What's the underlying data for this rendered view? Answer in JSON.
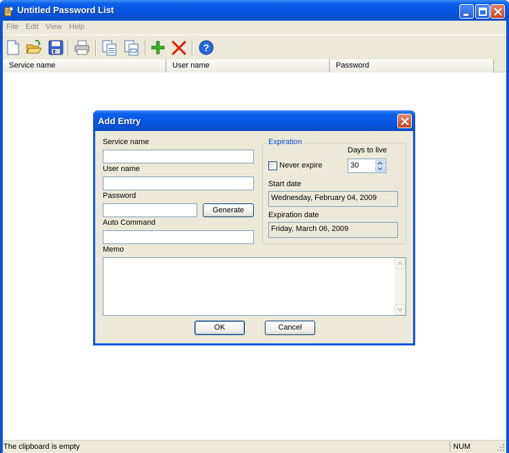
{
  "window": {
    "title": "Untitled Password List"
  },
  "menu": [
    "File",
    "Edit",
    "View",
    "Help"
  ],
  "toolbar": {
    "items": [
      "new-file-icon",
      "open-folder-icon",
      "save-icon",
      "print-icon",
      "copy-user-icon",
      "copy-password-icon",
      "add-entry-icon",
      "delete-entry-icon",
      "help-icon"
    ]
  },
  "list": {
    "columns": [
      "Service name",
      "User name",
      "Password"
    ]
  },
  "status": {
    "message": "The clipboard is empty",
    "num": "NUM"
  },
  "dialog": {
    "title": "Add Entry",
    "service_label": "Service name",
    "service_value": "",
    "user_label": "User name",
    "user_value": "",
    "password_label": "Password",
    "password_value": "",
    "generate_label": "Generate",
    "autocommand_label": "Auto Command",
    "autocommand_value": "",
    "memo_label": "Memo",
    "memo_value": "",
    "expiration": {
      "group_label": "Expiration",
      "days_label": "Days to live",
      "days_value": "30",
      "never_expire_label": "Never expire",
      "never_expire_checked": false,
      "start_label": "Start date",
      "start_value": "Wednesday, February 04, 2009",
      "expiry_label": "Expiration date",
      "expiry_value": "Friday, March 06, 2009"
    },
    "ok_label": "OK",
    "cancel_label": "Cancel"
  },
  "colors": {
    "titlebar": "#0a5fe8",
    "face": "#ece9d8",
    "accent": "#0046d5"
  }
}
